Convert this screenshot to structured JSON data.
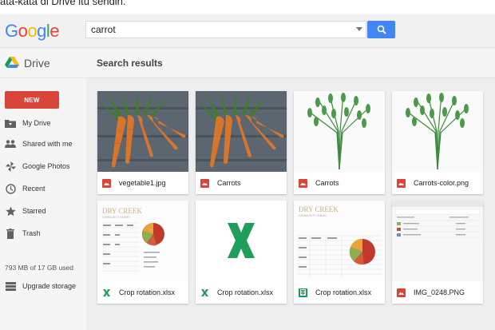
{
  "caption": "ata-kata di Drive itu sendiri.",
  "header": {
    "logo_letters": [
      {
        "ch": "G",
        "color": "#4285f4"
      },
      {
        "ch": "o",
        "color": "#ea4335"
      },
      {
        "ch": "o",
        "color": "#fbbc05"
      },
      {
        "ch": "g",
        "color": "#4285f4"
      },
      {
        "ch": "l",
        "color": "#34a853"
      },
      {
        "ch": "e",
        "color": "#ea4335"
      }
    ],
    "search_value": "carrot"
  },
  "drivebar": {
    "app_name": "Drive",
    "results_title": "Search results"
  },
  "sidebar": {
    "new_label": "NEW",
    "items": [
      {
        "label": "My Drive",
        "icon": "folder-icon"
      },
      {
        "label": "Shared with me",
        "icon": "people-icon"
      },
      {
        "label": "Google Photos",
        "icon": "pinwheel-icon"
      },
      {
        "label": "Recent",
        "icon": "clock-icon"
      },
      {
        "label": "Starred",
        "icon": "star-icon"
      },
      {
        "label": "Trash",
        "icon": "trash-icon"
      }
    ],
    "quota": "793 MB of 17 GB used",
    "upgrade_label": "Upgrade storage"
  },
  "files": [
    {
      "name": "vegetable1.jpg",
      "type": "image"
    },
    {
      "name": "Carrots",
      "type": "image"
    },
    {
      "name": "Carrots",
      "type": "image"
    },
    {
      "name": "Carrots-color.png",
      "type": "image"
    },
    {
      "name": "Crop rotation.xlsx",
      "type": "excel"
    },
    {
      "name": "Crop rotation.xlsx",
      "type": "excel"
    },
    {
      "name": "Crop rotation.xlsx",
      "type": "sheets"
    },
    {
      "name": "IMG_0248.PNG",
      "type": "image"
    }
  ],
  "thumb_text": {
    "dry_creek": "DRY CREEK",
    "community_farms": "COMMUNITY FARMS"
  },
  "colors": {
    "accent": "#4285f4",
    "new_button": "#d9453a",
    "image_type": "#db4437",
    "excel_type": "#1e9e5a",
    "sheets_type": "#0f9d58"
  }
}
